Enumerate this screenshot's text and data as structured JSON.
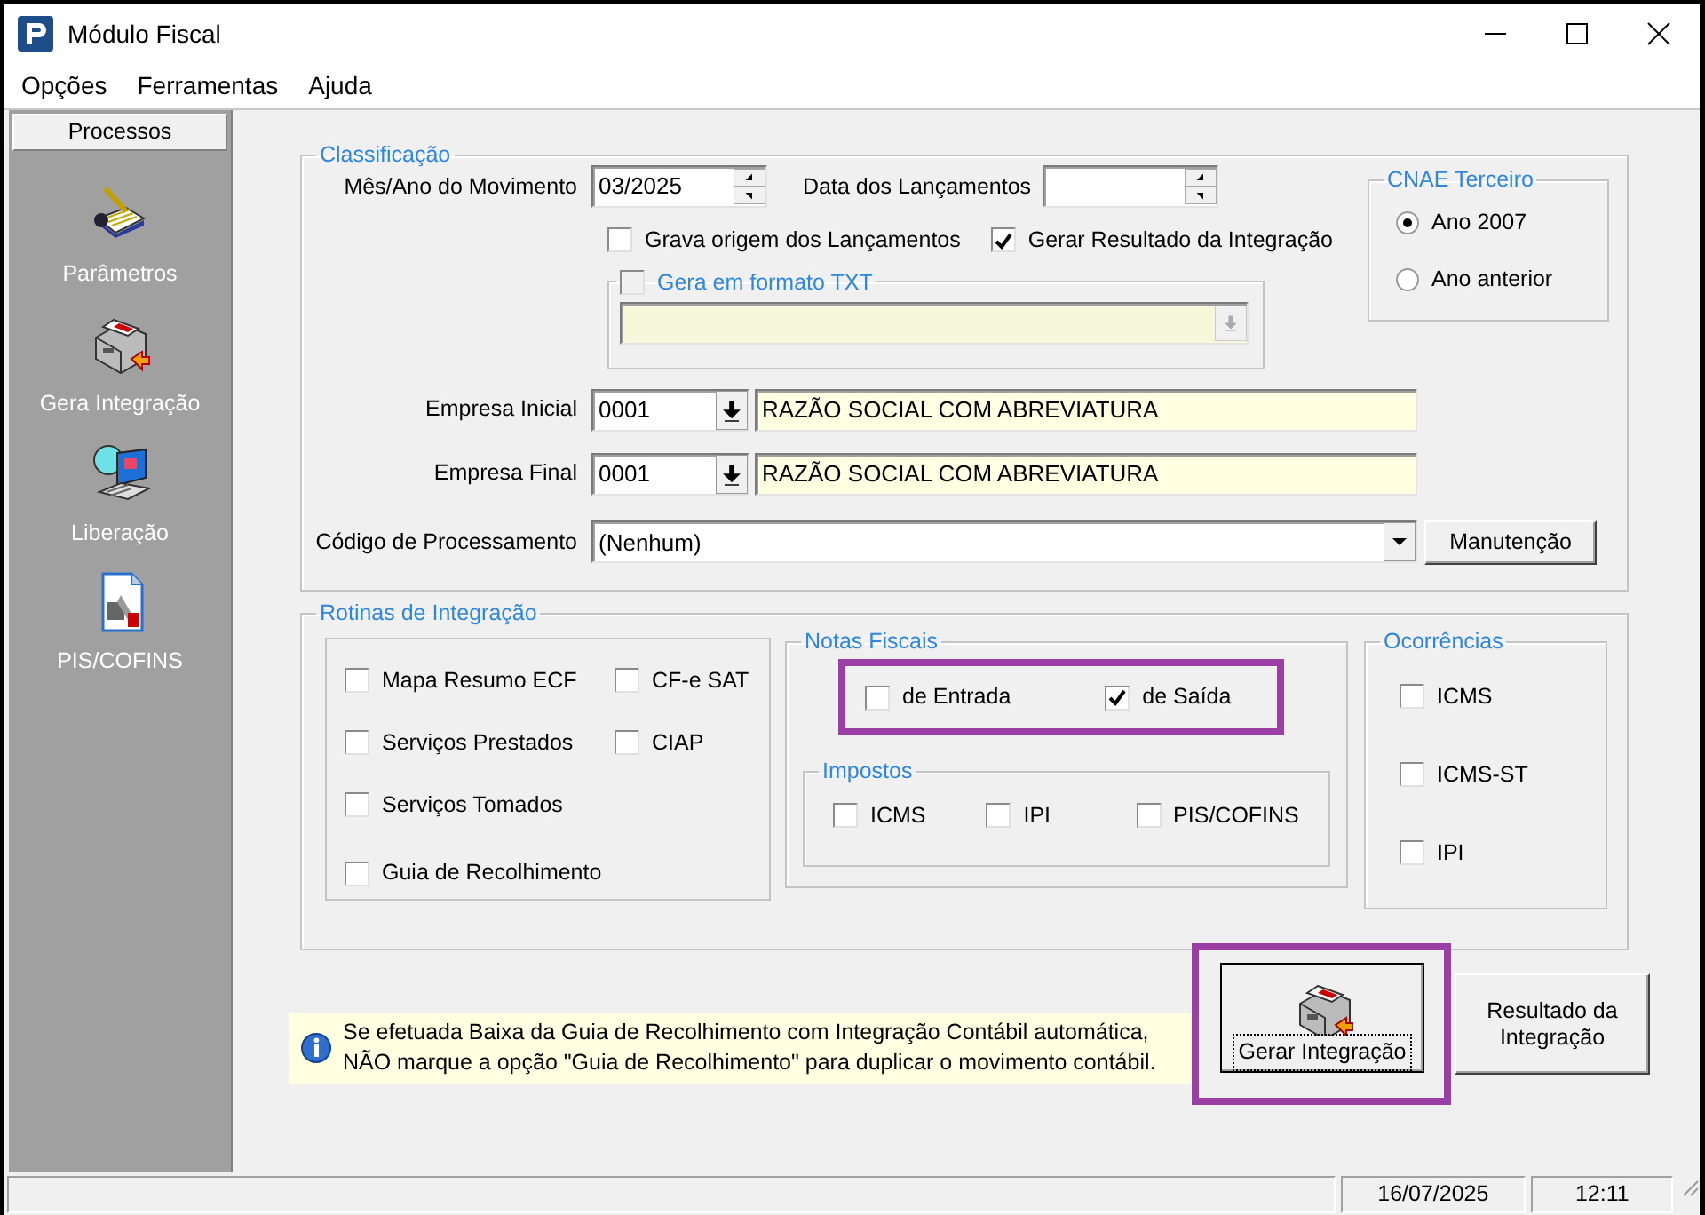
{
  "window": {
    "title": "Módulo Fiscal"
  },
  "menu": [
    "Opções",
    "Ferramentas",
    "Ajuda"
  ],
  "sidebar": {
    "header": "Processos",
    "items": [
      {
        "label": "Parâmetros",
        "kind": "notepad"
      },
      {
        "label": "Gera Integração",
        "kind": "machine"
      },
      {
        "label": "Liberação",
        "kind": "laptop"
      },
      {
        "label": "PIS/COFINS",
        "kind": "document"
      }
    ]
  },
  "classificacao": {
    "legend": "Classificação",
    "mes_ano": {
      "label": "Mês/Ano do Movimento",
      "value": "03/2025"
    },
    "data_lancamentos": {
      "label": "Data dos Lançamentos"
    },
    "grava_origem": {
      "label": "Grava origem dos Lançamentos",
      "checked": false
    },
    "gerar_resultado": {
      "label": "Gerar Resultado da Integração",
      "checked": true
    },
    "txt": {
      "label": "Gera em formato TXT",
      "checked": false,
      "disabled": true
    },
    "empresas": [
      {
        "label": "Empresa Inicial",
        "code": "0001",
        "name": "RAZÃO SOCIAL COM ABREVIATURA"
      },
      {
        "label": "Empresa Final",
        "code": "0001",
        "name": "RAZÃO SOCIAL COM ABREVIATURA"
      }
    ],
    "codigo": {
      "label": "Código de Processamento",
      "value": "(Nenhum)"
    },
    "manutencao": "Manutenção"
  },
  "cnae": {
    "legend": "CNAE Terceiro",
    "options": [
      {
        "label": "Ano 2007",
        "selected": true
      },
      {
        "label": "Ano anterior",
        "selected": false
      }
    ]
  },
  "rotinas": {
    "legend": "Rotinas de Integração",
    "column_1": [
      {
        "label": "Mapa Resumo ECF",
        "checked": false
      },
      {
        "label": "Serviços Prestados",
        "checked": false
      },
      {
        "label": "Serviços Tomados",
        "checked": false
      },
      {
        "label": "Guia de Recolhimento",
        "checked": false
      }
    ],
    "column_2": [
      {
        "label": "CF-e SAT",
        "checked": false
      },
      {
        "label": "CIAP",
        "checked": false
      }
    ],
    "notas": {
      "legend": "Notas Fiscais",
      "highlighted": true,
      "options": [
        {
          "label": "de Entrada",
          "checked": false
        },
        {
          "label": "de Saída",
          "checked": true
        }
      ]
    },
    "impostos": {
      "legend": "Impostos",
      "options": [
        {
          "label": "ICMS",
          "checked": false
        },
        {
          "label": "IPI",
          "checked": false
        },
        {
          "label": "PIS/COFINS",
          "checked": false
        }
      ]
    },
    "ocorrencias": {
      "legend": "Ocorrências",
      "options": [
        {
          "label": "ICMS",
          "checked": false
        },
        {
          "label": "ICMS-ST",
          "checked": false
        },
        {
          "label": "IPI",
          "checked": false
        }
      ]
    }
  },
  "info": "Se efetuada Baixa da Guia de Recolhimento com Integração Contábil automática,\nNÃO marque a opção \"Guia de Recolhimento\" para duplicar o movimento contábil.",
  "buttons": [
    {
      "label": "Gerar Integração",
      "highlighted": true,
      "focused": true,
      "kind": "icon"
    },
    {
      "label": "Resultado da\nIntegração",
      "highlighted": false,
      "focused": false,
      "kind": "text"
    }
  ],
  "status_bar": {
    "date": "16/07/2025",
    "time": "12:11"
  }
}
